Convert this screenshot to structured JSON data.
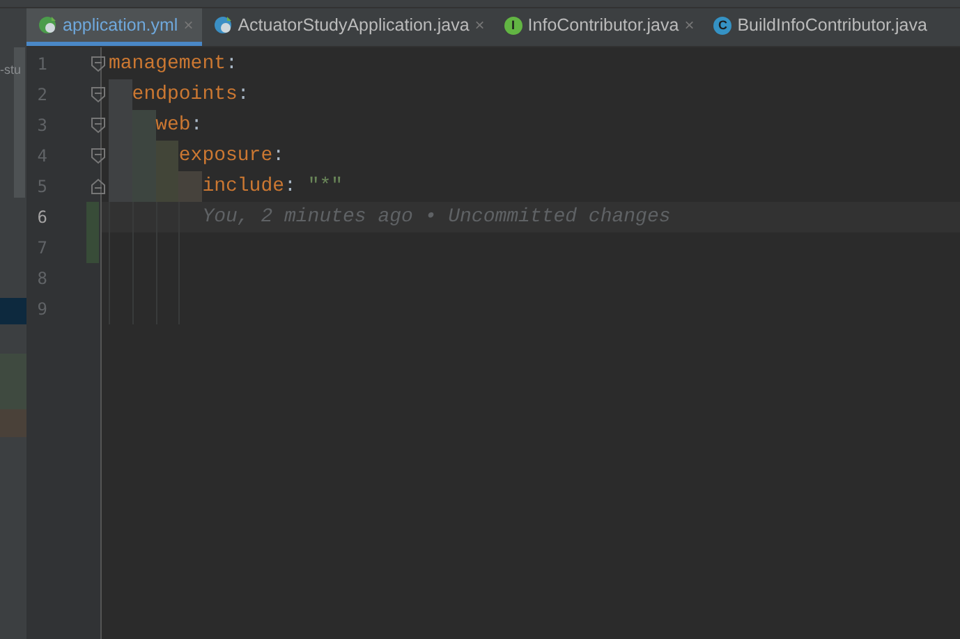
{
  "project_panel": {
    "text": "-stu"
  },
  "tabs": [
    {
      "label": "application.yml",
      "kind": "yaml",
      "selected": true,
      "close": "×"
    },
    {
      "label": "ActuatorStudyApplication.java",
      "kind": "app",
      "selected": false,
      "close": "×"
    },
    {
      "label": "InfoContributor.java",
      "kind": "interface",
      "icon_letter": "I",
      "selected": false,
      "close": "×"
    },
    {
      "label": "BuildInfoContributor.java",
      "kind": "class",
      "icon_letter": "C",
      "selected": false
    }
  ],
  "editor": {
    "lines": [
      {
        "key": "management",
        "punct": ":",
        "children": [
          {
            "key": "endpoints",
            "punct": ":",
            "children": [
              {
                "key": "web",
                "punct": ":",
                "children": [
                  {
                    "key": "exposure",
                    "punct": ":",
                    "children": [
                      {
                        "key": "include",
                        "punct": ":",
                        "value": "\"*\""
                      }
                    ]
                  }
                ]
              }
            ]
          }
        ]
      }
    ],
    "current_line": {
      "blame": "You, 2 minutes ago • Uncommitted changes"
    },
    "line_numbers": [
      "1",
      "2",
      "3",
      "4",
      "5",
      "6",
      "7",
      "8",
      "9"
    ]
  }
}
